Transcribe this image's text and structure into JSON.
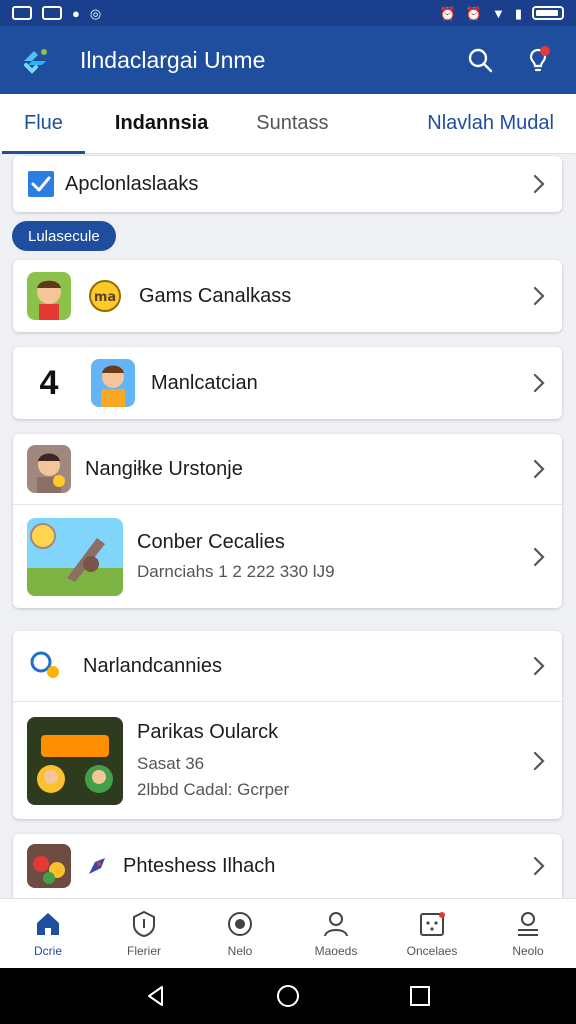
{
  "app": {
    "title": "Ilndaclargai Unme"
  },
  "tabs": [
    {
      "label": "Flue"
    },
    {
      "label": "Indannsia"
    },
    {
      "label": "Suntass"
    },
    {
      "label": "Nlavlah Mudal"
    }
  ],
  "section1": {
    "label": "Apclonlaslaaks"
  },
  "chip": {
    "label": "Lulasecule"
  },
  "list": {
    "item1": {
      "label": "Gams Canalkass"
    },
    "item2": {
      "prefix": "4",
      "label": "Manlcatcian"
    },
    "item3": {
      "label": "Nangiłke Urstonje"
    },
    "item4": {
      "label": "Conber Cecalies",
      "sub": "Darnciahs 1 2 222 330 lJ9"
    },
    "item5": {
      "label": "Narlandcannies"
    },
    "item6": {
      "label": "Parikas Oularck",
      "sub1": "Sasat 36",
      "sub2": "2lbbd Cadal: Gcrper"
    },
    "item7": {
      "label": "Phteshess Ilhach"
    }
  },
  "nav": [
    {
      "label": "Dcrie",
      "icon": "home-icon"
    },
    {
      "label": "Flerier",
      "icon": "shield-icon"
    },
    {
      "label": "Nelo",
      "icon": "compass-icon"
    },
    {
      "label": "Maoeds",
      "icon": "person-icon"
    },
    {
      "label": "Oncelaes",
      "icon": "calendar-icon"
    },
    {
      "label": "Neolo",
      "icon": "account-icon"
    }
  ],
  "colors": {
    "primary": "#1f4e9e",
    "statusbar": "#1a3f8c",
    "accent_red": "#e53935"
  }
}
